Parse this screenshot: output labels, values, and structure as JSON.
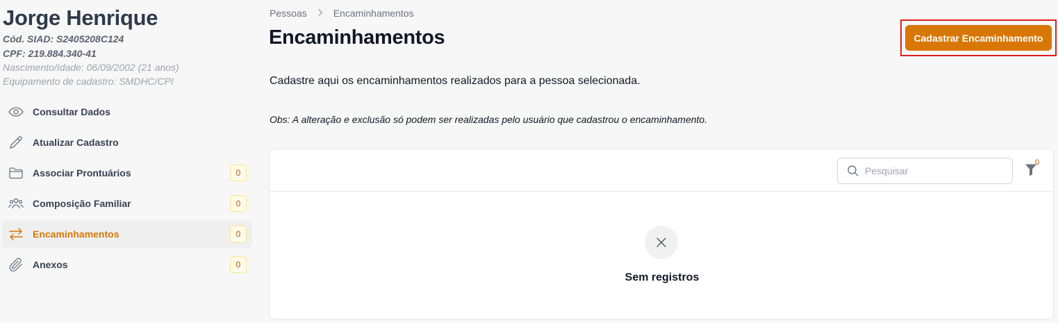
{
  "person": {
    "name": "Jorge Henrique",
    "siad": "Cód. SIAD: S2405208C124",
    "cpf": "CPF: 219.884.340-41",
    "birth": "Nascimento/Idade: 06/09/2002 (21 anos)",
    "equipment": "Equipamento de cadastro: SMDHC/CPI"
  },
  "sidebar": {
    "items": [
      {
        "label": "Consultar Dados",
        "icon": "eye-icon",
        "badge": null,
        "active": false
      },
      {
        "label": "Atualizar Cadastro",
        "icon": "pencil-icon",
        "badge": null,
        "active": false
      },
      {
        "label": "Associar Prontuários",
        "icon": "folder-icon",
        "badge": "0",
        "active": false
      },
      {
        "label": "Composição Familiar",
        "icon": "users-icon",
        "badge": "0",
        "active": false
      },
      {
        "label": "Encaminhamentos",
        "icon": "arrows-exchange-icon",
        "badge": "0",
        "active": true
      },
      {
        "label": "Anexos",
        "icon": "paperclip-icon",
        "badge": "0",
        "active": false
      }
    ]
  },
  "breadcrumb": {
    "items": [
      "Pessoas",
      "Encaminhamentos"
    ],
    "separator_icon": "chevron-right-icon"
  },
  "header": {
    "title": "Encaminhamentos",
    "primary_button": "Cadastrar Encaminhamento"
  },
  "description": "Cadastre aqui os encaminhamentos realizados para a pessoa selecionada.",
  "obs": "Obs: A alteração e exclusão só podem ser realizadas pelo usuário que cadastrou o encaminhamento.",
  "table": {
    "search_placeholder": "Pesquisar",
    "filter_count": "0",
    "empty_text": "Sem registros"
  },
  "colors": {
    "accent": "#d97706",
    "highlight_border": "#e11d1d"
  }
}
